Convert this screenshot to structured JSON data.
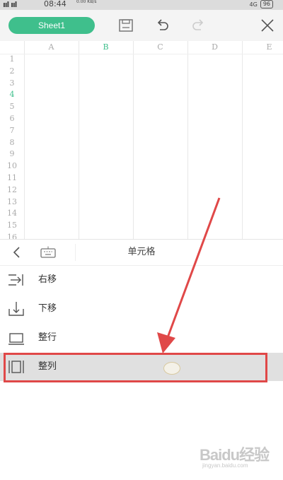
{
  "status_bar": {
    "signal": "ııl ııl",
    "time": "08:44",
    "network": "0.00 KB/s",
    "network_type": "4G",
    "battery": "96"
  },
  "toolbar": {
    "sheet_tab": "Sheet1",
    "icons": [
      "save-icon",
      "undo-icon",
      "redo-icon",
      "close-icon"
    ]
  },
  "grid": {
    "columns": [
      "A",
      "B",
      "C",
      "D",
      "E"
    ],
    "active_column": "B",
    "rows": [
      "1",
      "2",
      "3",
      "4",
      "5",
      "6",
      "7",
      "8",
      "9",
      "10",
      "11",
      "12",
      "13",
      "14",
      "15",
      "16"
    ],
    "active_row": "4"
  },
  "panel": {
    "title": "单元格",
    "options": [
      {
        "label": "右移",
        "icon": "shift-right-icon"
      },
      {
        "label": "下移",
        "icon": "shift-down-icon"
      },
      {
        "label": "整行",
        "icon": "entire-row-icon"
      },
      {
        "label": "整列",
        "icon": "entire-column-icon",
        "selected": true
      }
    ]
  },
  "annotation": {
    "highlight_color": "#e04848"
  },
  "watermark": {
    "logo": "Baidu经验",
    "url": "jingyan.baidu.com"
  },
  "colors": {
    "accent": "#3fbf8c",
    "selected_row": "#e0e0e0"
  }
}
